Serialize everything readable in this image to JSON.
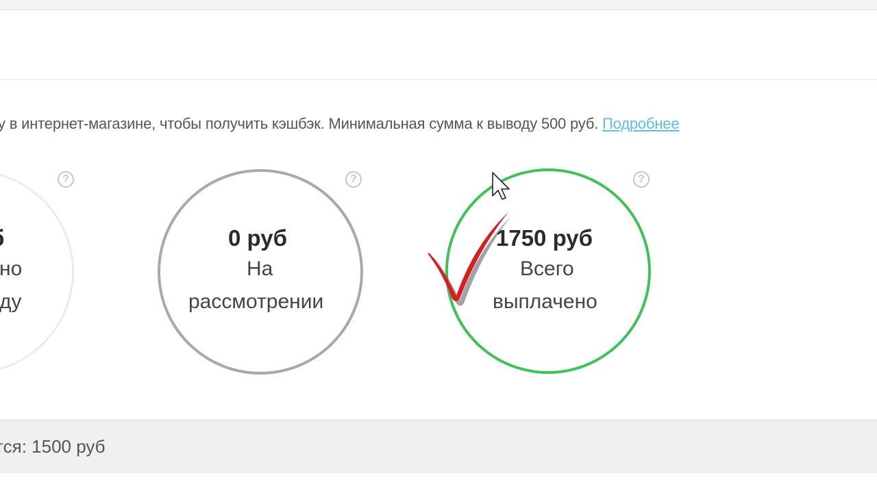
{
  "info": {
    "text": "у в интернет-магазине, чтобы получить кэшбэк. Минимальная сумма к выводу 500 руб.",
    "link": "Подробнее"
  },
  "stats": [
    {
      "amount": "б",
      "line1": "но",
      "line2": "ду",
      "help": "?"
    },
    {
      "amount": "0 руб",
      "line1": "На",
      "line2": "рассмотрении",
      "help": "?"
    },
    {
      "amount": "1750 руб",
      "line1": "Всего",
      "line2": "выплачено",
      "help": "?"
    }
  ],
  "footer": {
    "text": "тся: 1500 руб"
  },
  "colors": {
    "accent_link": "#5bc0de",
    "circle_grey": "#a9a9a9",
    "circle_light": "#ececec",
    "circle_green": "#3fc25a",
    "checkmark": "#d81e1e"
  },
  "icons": {
    "help": "question-circle-icon",
    "checkmark": "red-checkmark-annotation",
    "cursor": "mouse-pointer-icon"
  }
}
